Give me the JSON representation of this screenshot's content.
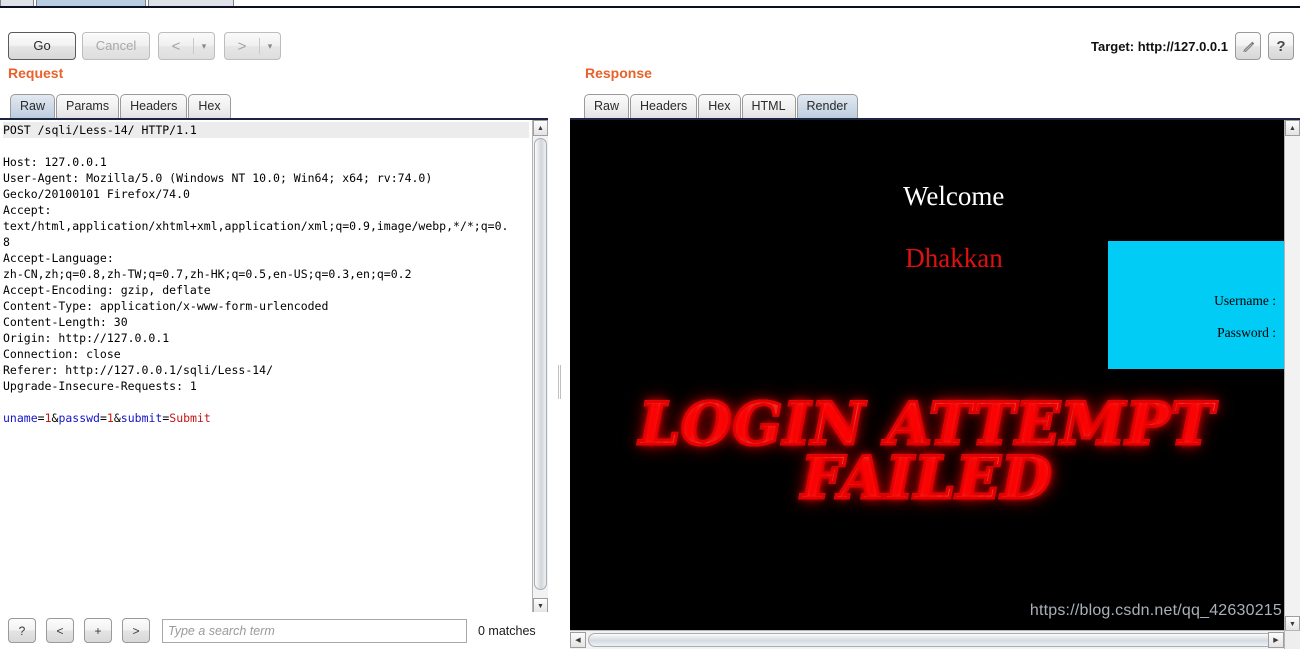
{
  "window": {
    "top_tabs": [
      {
        "label": "",
        "selected": false
      },
      {
        "label": "",
        "selected": true
      },
      {
        "label": "",
        "selected": false
      }
    ]
  },
  "toolbar": {
    "go_label": "Go",
    "cancel_label": "Cancel",
    "back_glyph": "<",
    "forward_glyph": ">",
    "caret_glyph": "▾",
    "target_label": "Target: http://127.0.0.1",
    "edit_icon": "pencil-icon",
    "help_label": "?"
  },
  "request": {
    "title": "Request",
    "tabs": [
      {
        "label": "Raw",
        "selected": true
      },
      {
        "label": "Params",
        "selected": false
      },
      {
        "label": "Headers",
        "selected": false
      },
      {
        "label": "Hex",
        "selected": false
      }
    ],
    "request_line": "POST /sqli/Less-14/ HTTP/1.1",
    "headers": [
      "Host: 127.0.0.1",
      "User-Agent: Mozilla/5.0 (Windows NT 10.0; Win64; x64; rv:74.0)",
      "Gecko/20100101 Firefox/74.0",
      "Accept:",
      "text/html,application/xhtml+xml,application/xml;q=0.9,image/webp,*/*;q=0.",
      "8",
      "Accept-Language:",
      "zh-CN,zh;q=0.8,zh-TW;q=0.7,zh-HK;q=0.5,en-US;q=0.3,en;q=0.2",
      "Accept-Encoding: gzip, deflate",
      "Content-Type: application/x-www-form-urlencoded",
      "Content-Length: 30",
      "Origin: http://127.0.0.1",
      "Connection: close",
      "Referer: http://127.0.0.1/sqli/Less-14/",
      "Upgrade-Insecure-Requests: 1"
    ],
    "body_params": [
      {
        "name": "uname",
        "value": "1",
        "sep": "&"
      },
      {
        "name": "passwd",
        "value": "1",
        "sep": "&"
      },
      {
        "name": "submit",
        "value": "Submit",
        "sep": ""
      }
    ],
    "body_raw": "uname=1&passwd=1&submit=Submit"
  },
  "search": {
    "help_label": "?",
    "prev_label": "<",
    "add_label": "+",
    "next_label": ">",
    "placeholder": "Type a search term",
    "value": "",
    "matches_label": "0 matches"
  },
  "response": {
    "title": "Response",
    "tabs": [
      {
        "label": "Raw",
        "selected": false
      },
      {
        "label": "Headers",
        "selected": false
      },
      {
        "label": "Hex",
        "selected": false
      },
      {
        "label": "HTML",
        "selected": false
      },
      {
        "label": "Render",
        "selected": true
      }
    ],
    "render": {
      "welcome_text": "Welcome",
      "user_text": "Dhakkan",
      "login_box": {
        "username_label": "Username :",
        "password_label": "Password :",
        "background": "#00ccf5"
      },
      "failed_line1": "LOGIN ATTEMPT",
      "failed_line2": "FAILED",
      "watermark": "https://blog.csdn.net/qq_42630215",
      "background": "#000000"
    }
  },
  "colors": {
    "panel_heading": "#e8622a",
    "param_name": "#1414c8",
    "param_value": "#c81414",
    "cyan_box": "#00ccf5",
    "welcome_user": "#e01010",
    "failed_glow": "#ff0000"
  }
}
